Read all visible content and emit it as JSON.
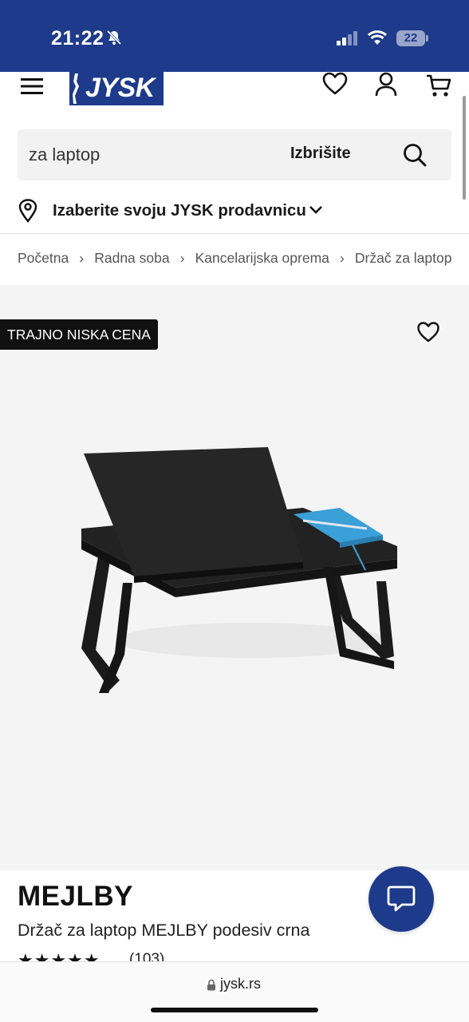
{
  "status_bar": {
    "time": "21:22",
    "battery_level": "22",
    "icons": [
      "bell-slash-icon",
      "signal-icon",
      "wifi-icon",
      "battery-icon"
    ]
  },
  "header": {
    "logo_text": "JYSK",
    "icons": [
      "menu-icon",
      "heart-icon",
      "user-icon",
      "cart-icon"
    ]
  },
  "search": {
    "value": "za laptop",
    "clear_label": "Izbrišite"
  },
  "store": {
    "label": "Izaberite svoju JYSK prodavnicu"
  },
  "breadcrumb": [
    "Početna",
    "Radna soba",
    "Kancelarijska oprema",
    "Držač za laptop"
  ],
  "product": {
    "badge": "TRAJNO NISKA CENA",
    "brand": "MEJLBY",
    "name": "Držač za laptop MEJLBY podesiv crna",
    "rating_stars": "★★★★★",
    "rating_value": 4.5,
    "rating_count": "(103)"
  },
  "browser": {
    "url": "jysk.rs"
  },
  "colors": {
    "brand_blue": "#1e3a8a",
    "badge_black": "#111111",
    "image_bg": "#f4f4f4"
  }
}
